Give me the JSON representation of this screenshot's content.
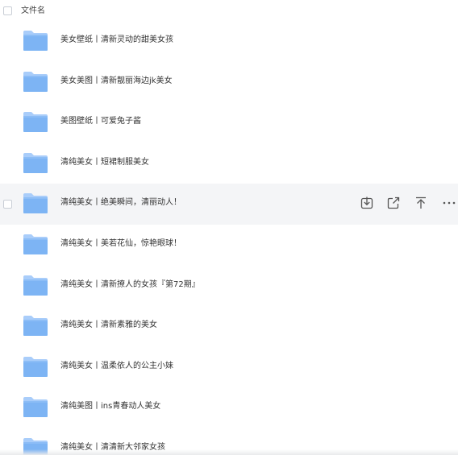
{
  "header": {
    "column_label": "文件名"
  },
  "colors": {
    "folder_fill": "#7db4f4",
    "folder_tab": "#a9cdfa",
    "hover_row_bg": "#f4f5f7",
    "icon_stroke": "#555555"
  },
  "actions": {
    "download_icon": "download-icon",
    "share_icon": "share-icon",
    "move_top_icon": "move-to-top-icon",
    "more_icon": "more-icon",
    "more_label": "···"
  },
  "files": [
    {
      "name": "美女壁纸丨清新灵动的甜美女孩",
      "hovered": false
    },
    {
      "name": "美女美图丨清新靓丽海边jk美女",
      "hovered": false
    },
    {
      "name": "美图壁纸丨可爱兔子酱",
      "hovered": false
    },
    {
      "name": "清纯美女丨短裙制服美女",
      "hovered": false
    },
    {
      "name": "清纯美女丨绝美瞬间，清丽动人！",
      "hovered": true
    },
    {
      "name": "清纯美女丨美若花仙，惊艳眼球！",
      "hovered": false
    },
    {
      "name": "清纯美女丨清新撩人的女孩『第72期』",
      "hovered": false
    },
    {
      "name": "清纯美女丨清新素雅的美女",
      "hovered": false
    },
    {
      "name": "清纯美女丨温柔依人的公主小妹",
      "hovered": false
    },
    {
      "name": "清纯美图丨ins青春动人美女",
      "hovered": false
    },
    {
      "name": "清纯美女丨清清新大邻家女孩",
      "hovered": false
    }
  ]
}
